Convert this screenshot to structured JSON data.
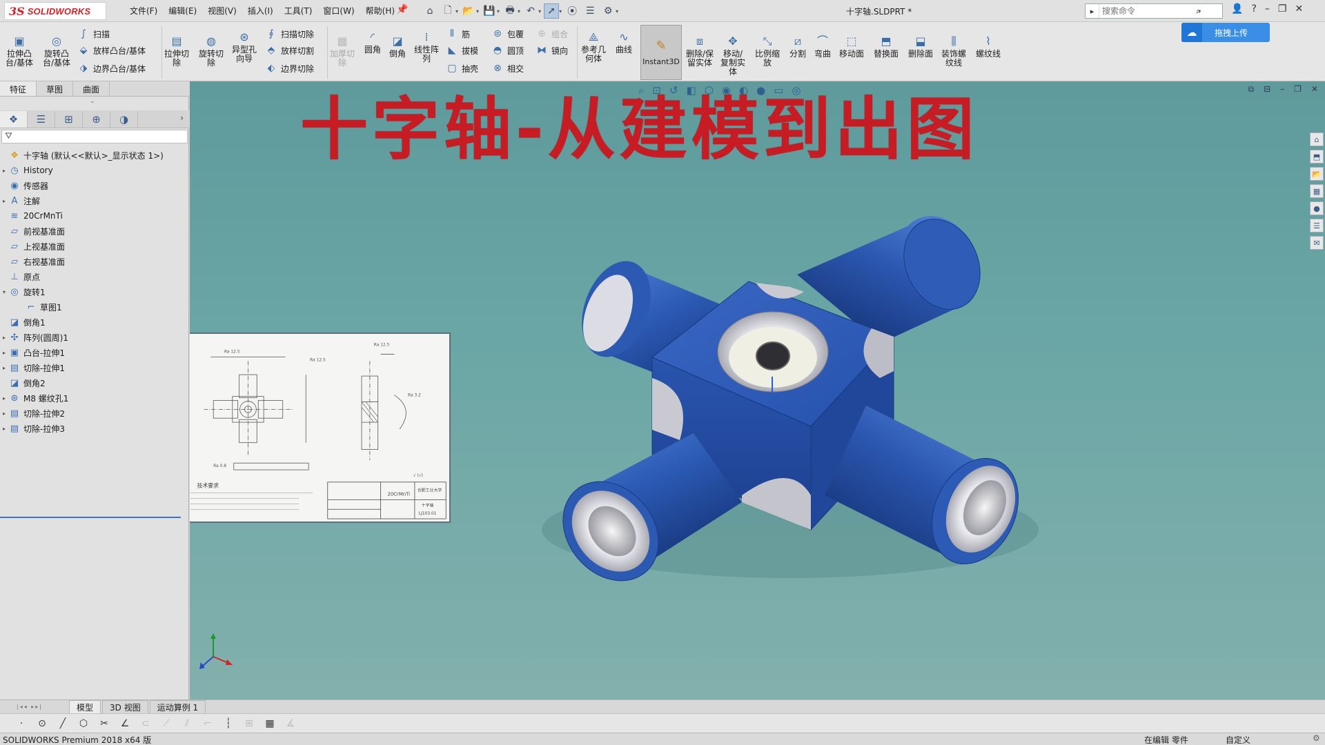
{
  "app": {
    "brand_ds": "3S",
    "brand_name": "SOLIDWORKS",
    "document_title": "十字轴.SLDPRT *",
    "menu": [
      "文件(F)",
      "编辑(E)",
      "视图(V)",
      "插入(I)",
      "工具(T)",
      "窗口(W)",
      "帮助(H)"
    ],
    "search_placeholder": "搜索命令",
    "window_controls": [
      "?",
      "–",
      "❐",
      "✕"
    ]
  },
  "cmd": {
    "extrude_boss": "拉伸凸\n台/基体",
    "revolve_boss": "旋转凸\n台/基体",
    "sweep": "扫描",
    "loft_boss": "放样凸台/基体",
    "boundary_boss": "边界凸台/基体",
    "extrude_cut": "拉伸切\n除",
    "revolve_cut": "旋转切\n除",
    "hole_wizard": "异型孔\n向导",
    "sweep_cut": "扫描切除",
    "loft_cut": "放样切割",
    "boundary_cut": "边界切除",
    "thicken_cut": "加厚切\n除",
    "fillet": "圆角",
    "chamfer": "倒角",
    "linear_pattern": "线性阵\n列",
    "rib": "筋",
    "draft": "拔模",
    "shell": "抽壳",
    "wrap": "包覆",
    "dome": "圆顶",
    "intersect": "相交",
    "combine": "组合",
    "mirror": "镜向",
    "ref_geometry": "参考几\n何体",
    "curves": "曲线",
    "instant3d": "Instant3D",
    "delete_keep_body": "删除/保\n留实体",
    "move_copy_body": "移动/\n复制实\n体",
    "scale": "比例缩\n放",
    "split": "分割",
    "flex": "弯曲",
    "move_face": "移动面",
    "replace_face": "替换面",
    "delete_face": "删除面",
    "cosmetic_thread": "装饰螺\n纹线",
    "thread": "螺纹线",
    "upload": "拖拽上传"
  },
  "tabs": {
    "features": "特征",
    "sketch": "草图",
    "surface": "曲面"
  },
  "tree": {
    "root": "十字轴  (默认<<默认>_显示状态 1>)",
    "items": [
      {
        "label": "History",
        "exp": "▸",
        "icon": "history-icon",
        "glyph": "◷",
        "indent": 0
      },
      {
        "label": "传感器",
        "exp": "",
        "icon": "sensor-icon",
        "glyph": "◉",
        "indent": 0
      },
      {
        "label": "注解",
        "exp": "▸",
        "icon": "annotation-icon",
        "glyph": "A",
        "indent": 0
      },
      {
        "label": "20CrMnTi",
        "exp": "",
        "icon": "material-icon",
        "glyph": "≋",
        "indent": 0
      },
      {
        "label": "前视基准面",
        "exp": "",
        "icon": "plane-icon",
        "glyph": "▱",
        "indent": 0
      },
      {
        "label": "上视基准面",
        "exp": "",
        "icon": "plane-icon",
        "glyph": "▱",
        "indent": 0
      },
      {
        "label": "右视基准面",
        "exp": "",
        "icon": "plane-icon",
        "glyph": "▱",
        "indent": 0
      },
      {
        "label": "原点",
        "exp": "",
        "icon": "origin-icon",
        "glyph": "⊥",
        "indent": 0
      },
      {
        "label": "旋转1",
        "exp": "▾",
        "icon": "revolve-icon",
        "glyph": "◎",
        "indent": 0
      },
      {
        "label": "草图1",
        "exp": "",
        "icon": "sketch-icon",
        "glyph": "⌐",
        "indent": 1
      },
      {
        "label": "倒角1",
        "exp": "",
        "icon": "chamfer-icon",
        "glyph": "◪",
        "indent": 0
      },
      {
        "label": "阵列(圆周)1",
        "exp": "▸",
        "icon": "circular-pattern-icon",
        "glyph": "✣",
        "indent": 0
      },
      {
        "label": "凸台-拉伸1",
        "exp": "▸",
        "icon": "extrude-icon",
        "glyph": "▣",
        "indent": 0
      },
      {
        "label": "切除-拉伸1",
        "exp": "▸",
        "icon": "cut-extrude-icon",
        "glyph": "▤",
        "indent": 0
      },
      {
        "label": "倒角2",
        "exp": "",
        "icon": "chamfer-icon",
        "glyph": "◪",
        "indent": 0
      },
      {
        "label": "M8 螺纹孔1",
        "exp": "▸",
        "icon": "hole-icon",
        "glyph": "⊛",
        "indent": 0
      },
      {
        "label": "切除-拉伸2",
        "exp": "▸",
        "icon": "cut-extrude-icon",
        "glyph": "▤",
        "indent": 0
      },
      {
        "label": "切除-拉伸3",
        "exp": "▸",
        "icon": "cut-extrude-icon",
        "glyph": "▤",
        "indent": 0
      }
    ]
  },
  "overlay": {
    "banner": "十字轴-从建模到出图",
    "drawing_tech": "技术要求",
    "drawing_material": "20CrMnTi",
    "drawing_name": "十字轴",
    "drawing_school": "合肥工业大学",
    "drawing_code": "LJ103.01"
  },
  "bottom": {
    "model_tabs": [
      "模型",
      "3D 视图",
      "运动算例 1"
    ],
    "status_left": "SOLIDWORKS Premium 2018 x64 版",
    "status_edit": "在编辑 零件",
    "status_custom": "自定义"
  },
  "colors": {
    "banner": "#c81c24",
    "body": "#2d5fb8",
    "viewport_bg": "#6aa6a5",
    "upload_button": "#3a8ee6"
  }
}
